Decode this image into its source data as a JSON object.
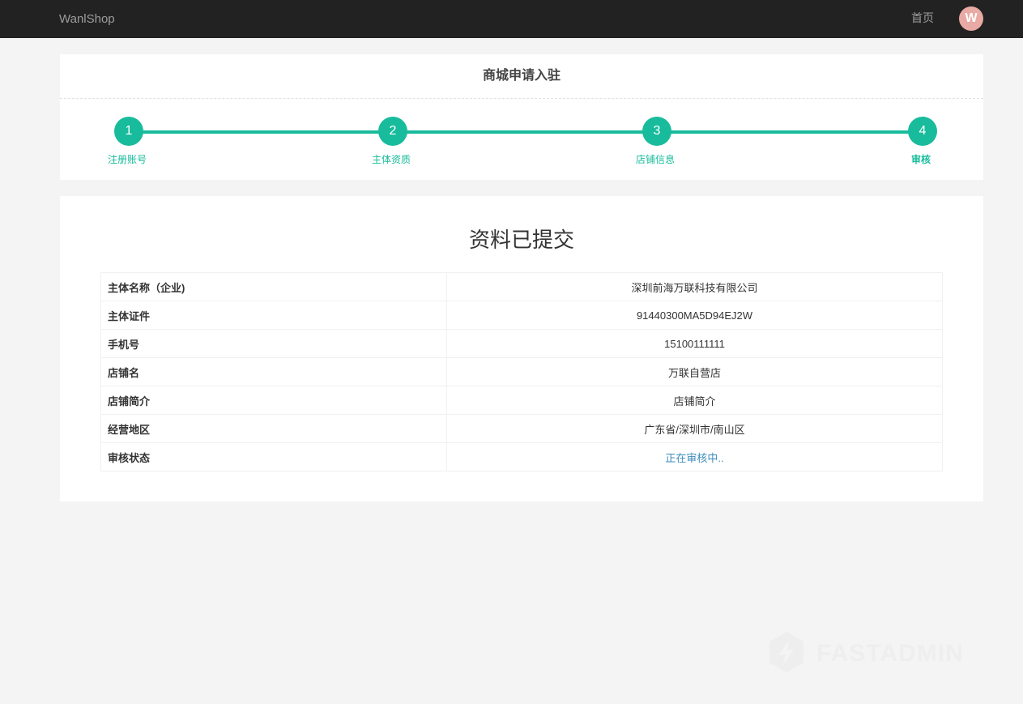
{
  "navbar": {
    "brand": "WanlShop",
    "home_label": "首页",
    "avatar_initial": "W"
  },
  "steps_panel": {
    "title": "商城申请入驻",
    "steps": [
      {
        "number": "1",
        "label": "注册账号"
      },
      {
        "number": "2",
        "label": "主体资质"
      },
      {
        "number": "3",
        "label": "店铺信息"
      },
      {
        "number": "4",
        "label": "审核"
      }
    ],
    "accent_color": "#18bc9c"
  },
  "info_panel": {
    "title": "资料已提交",
    "rows": [
      {
        "key": "主体名称（企业)",
        "value": "深圳前海万联科技有限公司"
      },
      {
        "key": "主体证件",
        "value": "91440300MA5D94EJ2W"
      },
      {
        "key": "手机号",
        "value": "15100111111"
      },
      {
        "key": "店铺名",
        "value": "万联自营店"
      },
      {
        "key": "店铺简介",
        "value": "店铺简介"
      },
      {
        "key": "经营地区",
        "value": "广东省/深圳市/南山区"
      },
      {
        "key": "审核状态",
        "value": "正在审核中.."
      }
    ],
    "status_color": "#3c8dbc"
  },
  "watermark": {
    "text": "FASTADMIN",
    "icon": "fastadmin-logo-icon"
  }
}
